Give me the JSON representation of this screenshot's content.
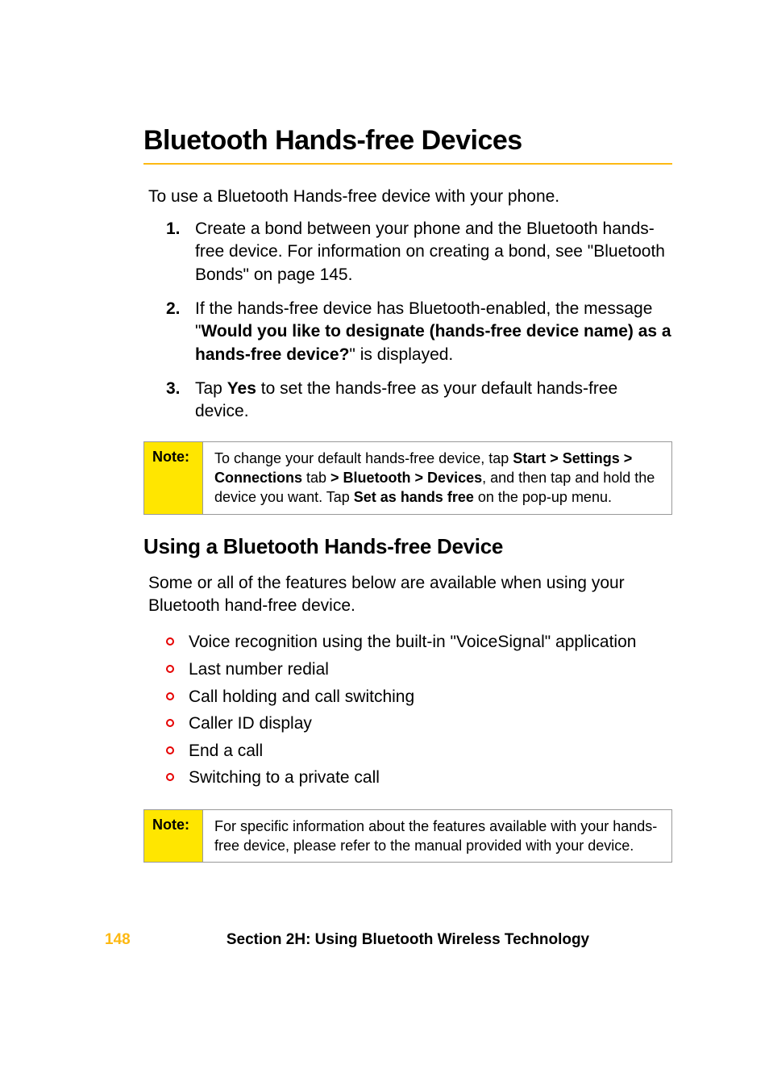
{
  "title": "Bluetooth Hands-free Devices",
  "intro": "To use a Bluetooth Hands-free device with your phone.",
  "steps": [
    {
      "num": "1.",
      "parts": [
        {
          "t": "Create a bond between your phone and the Bluetooth hands-free device. For information on creating a bond, see \"Bluetooth Bonds\" on page 145.",
          "b": false
        }
      ]
    },
    {
      "num": "2.",
      "parts": [
        {
          "t": "If the hands-free device has Bluetooth-enabled, the message \"",
          "b": false
        },
        {
          "t": "Would you like to designate (hands-free device name) as a hands-free device?",
          "b": true
        },
        {
          "t": "\" is displayed.",
          "b": false
        }
      ]
    },
    {
      "num": "3.",
      "parts": [
        {
          "t": "Tap ",
          "b": false
        },
        {
          "t": "Yes",
          "b": true
        },
        {
          "t": " to set the hands-free as your default hands-free device.",
          "b": false
        }
      ]
    }
  ],
  "note1": {
    "label": "Note:",
    "parts": [
      {
        "t": "To change your default hands-free device, tap ",
        "b": false
      },
      {
        "t": "Start > Settings > Connections",
        "b": true
      },
      {
        "t": " tab ",
        "b": false
      },
      {
        "t": "> Bluetooth > Devices",
        "b": true
      },
      {
        "t": ", and then tap and hold the device you want. Tap ",
        "b": false
      },
      {
        "t": "Set as hands free",
        "b": true
      },
      {
        "t": " on the pop-up menu.",
        "b": false
      }
    ]
  },
  "h2": "Using a Bluetooth Hands-free Device",
  "para2": "Some or all of the features below are available when using your Bluetooth hand-free device.",
  "bullets": [
    "Voice recognition using the built-in \"VoiceSignal\" application",
    "Last number redial",
    "Call holding and call switching",
    "Caller ID display",
    "End a call",
    "Switching to a private call"
  ],
  "note2": {
    "label": "Note:",
    "parts": [
      {
        "t": "For specific information about the features available with your hands-free device, please refer to the manual provided with your device.",
        "b": false
      }
    ]
  },
  "footer": {
    "page": "148",
    "title": "Section 2H: Using Bluetooth Wireless Technology"
  }
}
